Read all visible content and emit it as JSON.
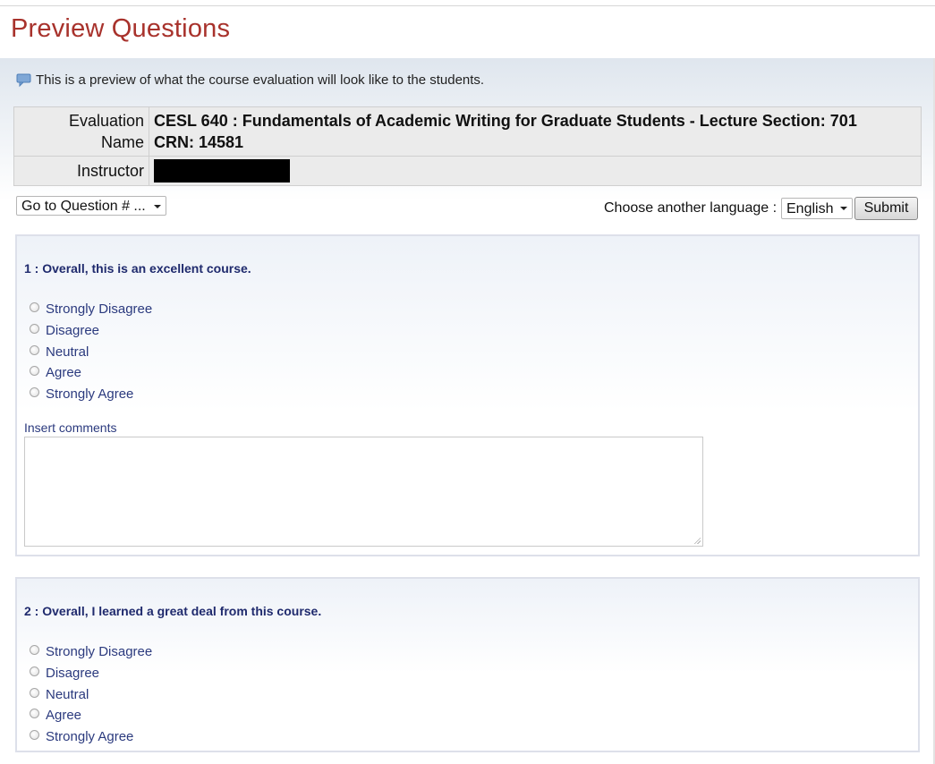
{
  "page_title": "Preview Questions",
  "notice": {
    "icon": "speech-bubble-icon",
    "text": "This is a preview of what the course evaluation will look like to the students."
  },
  "info": {
    "eval_label_line1": "Evaluation",
    "eval_label_line2": "Name",
    "eval_value_line1": "CESL 640 : Fundamentals of Academic Writing for Graduate Students - Lecture Section: 701",
    "eval_value_line2": "CRN: 14581",
    "instructor_label": "Instructor"
  },
  "controls": {
    "goto_question": "Go to Question # ...",
    "language_label": "Choose another language :",
    "language_value": "English",
    "submit_label": "Submit"
  },
  "questions": [
    {
      "title": "1 : Overall, this is an excellent course.",
      "options": [
        "Strongly Disagree",
        "Disagree",
        "Neutral",
        "Agree",
        "Strongly Agree"
      ],
      "comments_label": "Insert comments"
    },
    {
      "title": "2 : Overall, I learned a great deal from this course.",
      "options": [
        "Strongly Disagree",
        "Disagree",
        "Neutral",
        "Agree",
        "Strongly Agree"
      ]
    }
  ],
  "colors": {
    "title": "#a8322c",
    "question_text": "#1f2a6d",
    "option_text": "#2b3a7e"
  }
}
